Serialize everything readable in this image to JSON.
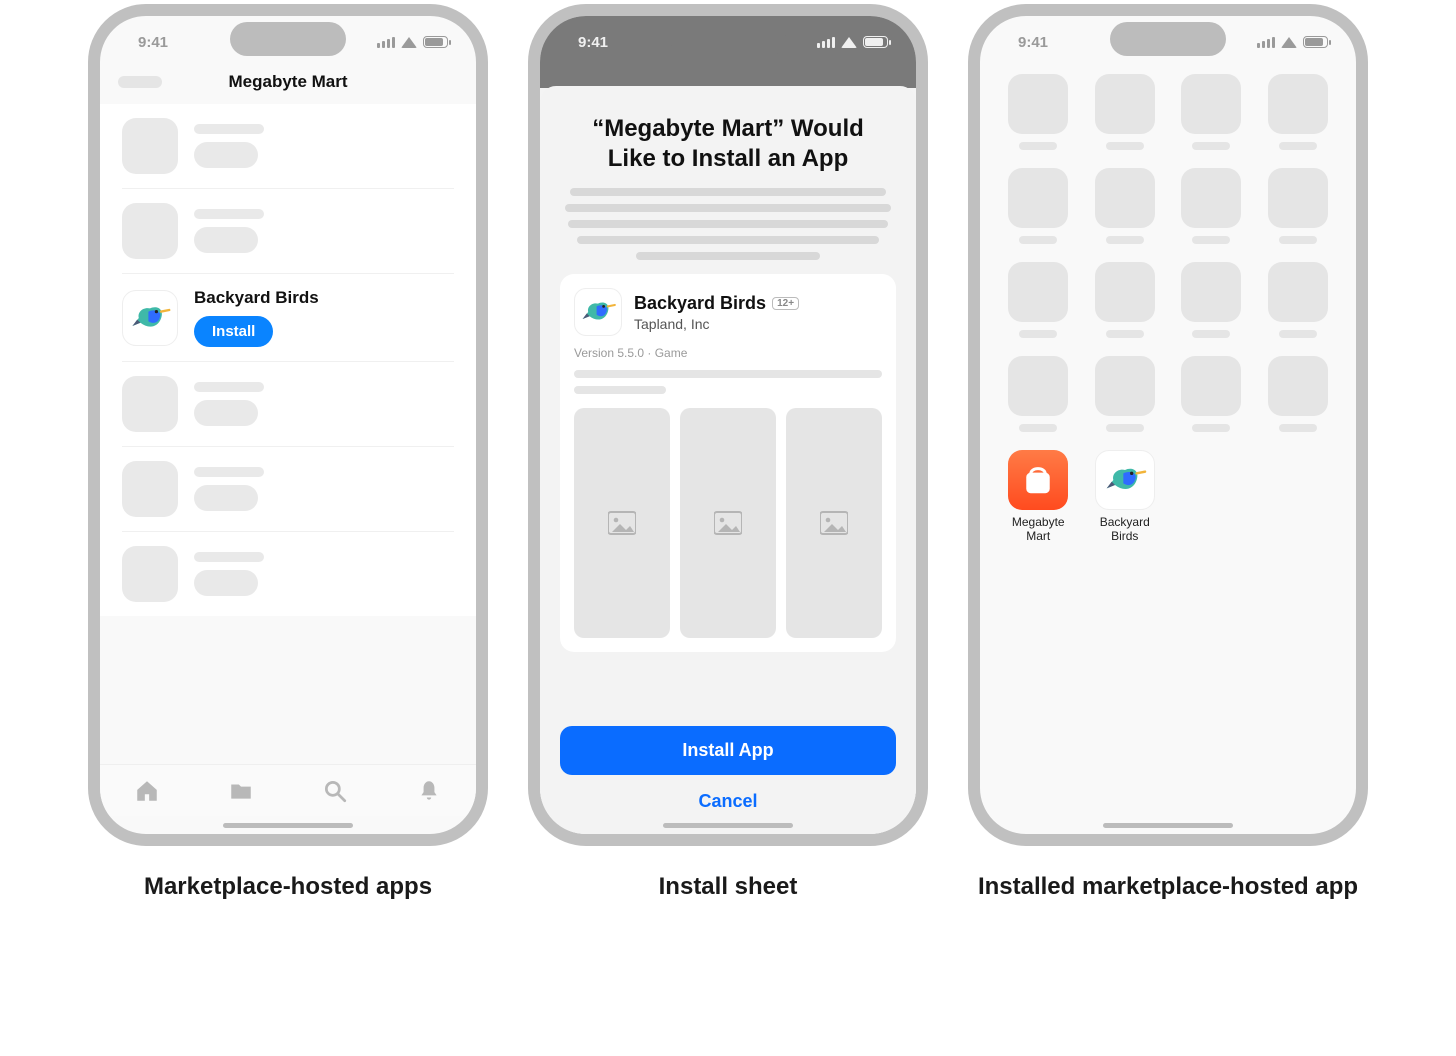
{
  "status_time": "9:41",
  "captions": {
    "p1": "Marketplace-hosted apps",
    "p2": "Install sheet",
    "p3": "Installed marketplace-hosted app"
  },
  "phone1": {
    "nav_title": "Megabyte Mart",
    "featured_app_name": "Backyard Birds",
    "install_label": "Install"
  },
  "phone2": {
    "sheet_title": "“Megabyte Mart” Would Like to Install an App",
    "app_name": "Backyard Birds",
    "developer": "Tapland, Inc",
    "age_rating": "12+",
    "version_line": "Version 5.5.0 · Game",
    "install_button": "Install App",
    "cancel_button": "Cancel"
  },
  "phone3": {
    "app1_name": "Megabyte Mart",
    "app2_name": "Backyard Birds"
  }
}
